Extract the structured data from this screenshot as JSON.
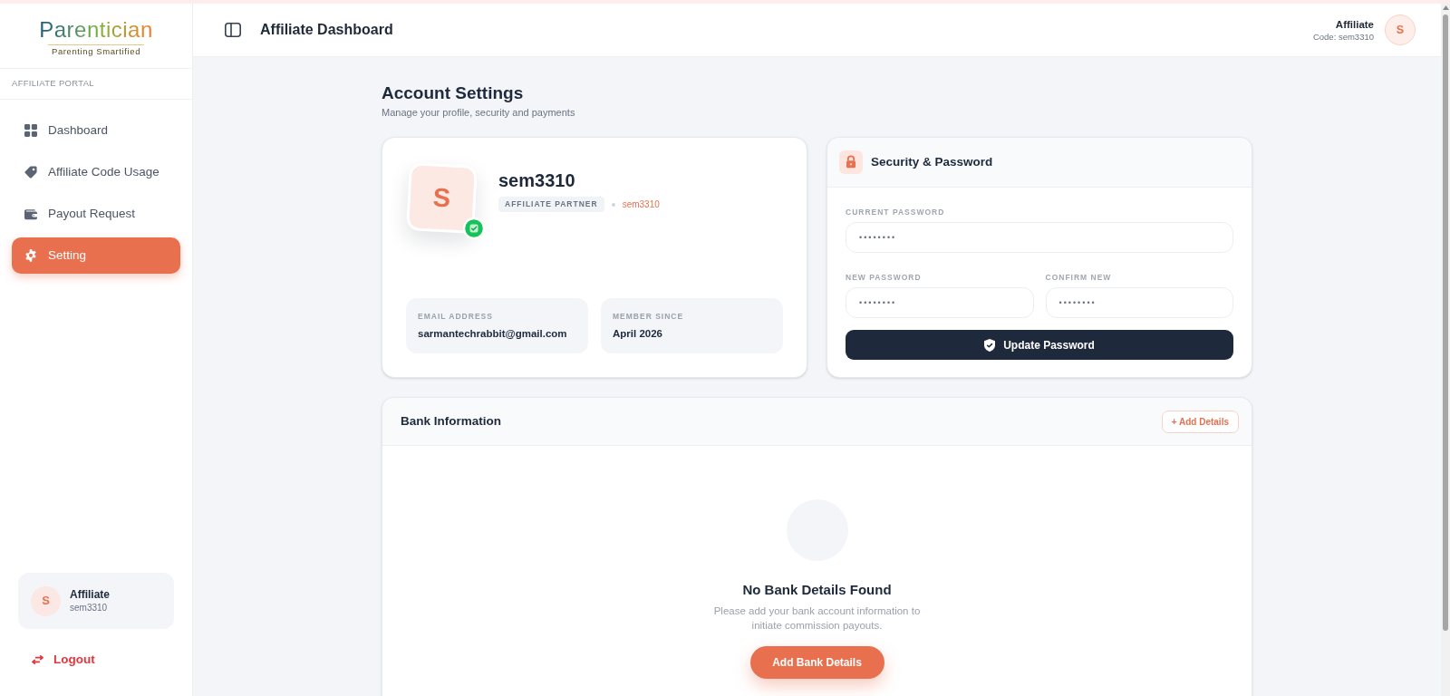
{
  "sidebar": {
    "logo": "Parentician",
    "tagline": "Parenting Smartified",
    "section_label": "AFFILIATE PORTAL",
    "items": [
      {
        "label": "Dashboard",
        "selected": false
      },
      {
        "label": "Affiliate Code Usage",
        "selected": false
      },
      {
        "label": "Payout Request",
        "selected": false
      },
      {
        "label": "Setting",
        "selected": true
      }
    ],
    "user": {
      "avatar": "S",
      "name": "Affiliate",
      "code": "sem3310"
    },
    "logout": "Logout"
  },
  "header": {
    "title": "Affiliate Dashboard",
    "user": {
      "role": "Affiliate",
      "code": "Code: sem3310",
      "avatar": "S"
    }
  },
  "page": {
    "title": "Account Settings",
    "subtitle": "Manage your profile, security and payments"
  },
  "profile": {
    "avatar": "S",
    "verified": true,
    "username": "sem3310",
    "badge": "AFFILIATE PARTNER",
    "code": "sem3310",
    "details": [
      {
        "label": "EMAIL ADDRESS",
        "value": "sarmantechrabbit@gmail.com"
      },
      {
        "label": "MEMBER SINCE",
        "value": "April 2026"
      }
    ]
  },
  "security": {
    "title": "Security & Password",
    "fields": [
      {
        "label": "CURRENT PASSWORD",
        "value": "••••••••"
      },
      {
        "label": "NEW PASSWORD",
        "value": "••••••••"
      },
      {
        "label": "CONFIRM NEW",
        "value": "••••••••"
      }
    ],
    "button": "Update Password"
  },
  "bank": {
    "title": "Bank Information",
    "add_button": "+ Add Details",
    "empty": {
      "title": "No Bank Details Found",
      "message": "Please add your bank account information to initiate commission payouts.",
      "button": "Add Bank Details"
    }
  }
}
